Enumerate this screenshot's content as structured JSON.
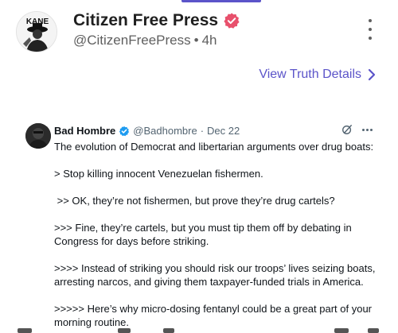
{
  "post": {
    "author_name": "Citizen Free Press",
    "handle": "@CitizenFreePress",
    "separator": "•",
    "time": "4h",
    "avatar_text": "KANE",
    "details_link": "View Truth Details"
  },
  "embed": {
    "name": "Bad Hombre",
    "handle": "@Badhombre",
    "separator": "·",
    "date": "Dec 22",
    "lines": {
      "intro": "The evolution of Democrat and libertarian arguments over drug boats:",
      "l1": "> Stop killing innocent Venezuelan fishermen.",
      "l2": " >> OK, they’re not fishermen, but prove they’re drug cartels?",
      "l3": ">>> Fine, they’re cartels, but you must tip them off by debating in Congress for days before striking.",
      "l4": ">>>> Instead of striking you should risk our troops’ lives seizing boats, arresting narcos, and giving them taxpayer-funded trials in America.",
      "l5": ">>>>> Here’s why micro-dosing fentanyl could be a great part of your morning routine."
    }
  },
  "colors": {
    "accent": "#5b54c9",
    "verified_badge": "#e8506c",
    "embed_verified": "#1d9bf0",
    "muted": "#5f5f5f"
  },
  "icons": {
    "more": "more-vertical-icon",
    "chevron": "chevron-right-icon",
    "grok": "grok-icon",
    "more_h": "more-horizontal-icon"
  }
}
